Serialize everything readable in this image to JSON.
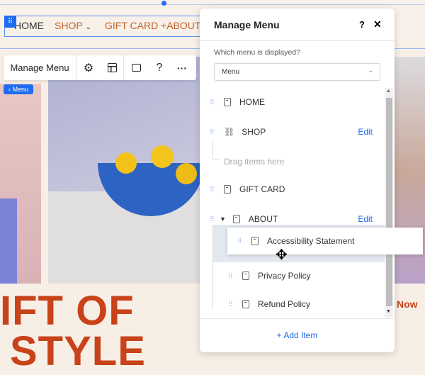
{
  "site": {
    "nav": [
      "HOME",
      "SHOP",
      "GIFT CARD",
      "+ABOUT"
    ],
    "hero_line1": "IFT OF",
    "hero_line2": "STYLE",
    "cta": "Now"
  },
  "toolbar": {
    "manage_menu": "Manage Menu",
    "icons": [
      "gear-icon",
      "layout-icon",
      "comment-icon",
      "help-icon",
      "more-icon"
    ],
    "help": "?",
    "more": "···"
  },
  "breadcrumb_badge": "‹ Menu",
  "panel": {
    "title": "Manage Menu",
    "help": "?",
    "close": "✕",
    "question": "Which menu is displayed?",
    "selected_menu": "Menu",
    "items": [
      {
        "label": "HOME"
      },
      {
        "label": "SHOP",
        "edit": "Edit"
      },
      {
        "placeholder": "Drag items here"
      },
      {
        "label": "GIFT CARD"
      },
      {
        "label": "ABOUT",
        "edit": "Edit"
      },
      {
        "label": "Accessibility Statement"
      },
      {
        "label": "Privacy Policy"
      },
      {
        "label": "Refund Policy"
      }
    ],
    "add_item": "+ Add Item"
  },
  "colors": {
    "accent": "#1e6cf0",
    "brand_orange": "#c8421a",
    "nav_text": "#c1622e"
  }
}
